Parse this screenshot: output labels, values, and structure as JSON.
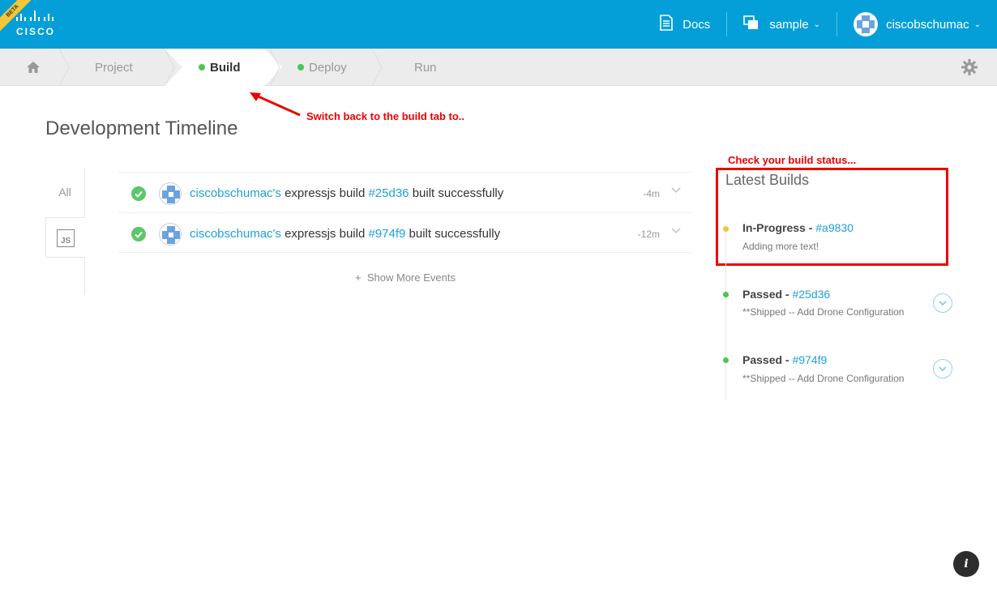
{
  "brand": {
    "beta_label": "BETA",
    "logo_text": "CISCO"
  },
  "topnav": {
    "docs_label": "Docs",
    "project_label": "sample",
    "user_label": "ciscobschumac"
  },
  "subnav": {
    "items": [
      {
        "label": "Project",
        "status": "none"
      },
      {
        "label": "Build",
        "status": "green"
      },
      {
        "label": "Deploy",
        "status": "green"
      },
      {
        "label": "Run",
        "status": "none"
      }
    ],
    "active": "Build"
  },
  "annotations": {
    "build_tab": "Switch back to the build tab to..",
    "build_status": "Check your build status..."
  },
  "page_title": "Development Timeline",
  "filters": {
    "all_label": "All",
    "js_label": "JS"
  },
  "events": [
    {
      "user": "ciscobschumac's",
      "text_a": " expressjs build ",
      "hash": "#25d36",
      "text_b": " built successfully",
      "time": "-4m"
    },
    {
      "user": "ciscobschumac's",
      "text_a": " expressjs build ",
      "hash": "#974f9",
      "text_b": " built successfully",
      "time": "-12m"
    }
  ],
  "show_more": "Show More Events",
  "latest_builds": {
    "title": "Latest Builds",
    "items": [
      {
        "status": "In-Progress - ",
        "hash": "#a9830",
        "message": "Adding more text!",
        "color": "#f3c735"
      },
      {
        "status": "Passed - ",
        "hash": "#25d36",
        "message": "**Shipped -- Add Drone Configuration",
        "color": "#4cc552"
      },
      {
        "status": "Passed - ",
        "hash": "#974f9",
        "message": "**Shipped -- Add Drone Configuration",
        "color": "#4cc552"
      }
    ]
  },
  "colors": {
    "topbar": "#049fd9",
    "link": "#1fa0d8",
    "success": "#5cc76a",
    "annotation": "#ee0000"
  },
  "info_label": "i"
}
